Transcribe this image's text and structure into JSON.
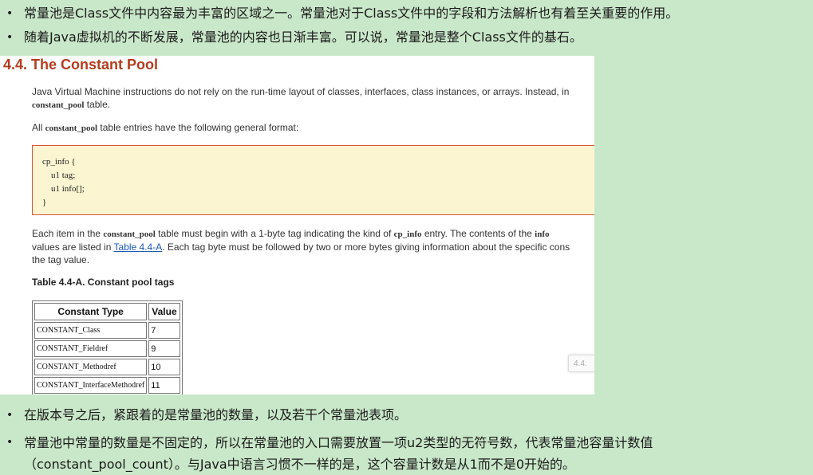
{
  "bullets": [
    {
      "symbol": "•",
      "text": "常量池是Class文件中内容最为丰富的区域之一。常量池对于Class文件中的字段和方法解析也有着至关重要的作用。"
    },
    {
      "symbol": "•",
      "text": "随着Java虚拟机的不断发展，常量池的内容也日渐丰富。可以说，常量池是整个Class文件的基石。"
    },
    {
      "symbol": "•",
      "text": "在版本号之后，紧跟着的是常量池的数量，以及若干个常量池表项。"
    },
    {
      "symbol": "•",
      "text": "常量池中常量的数量是不固定的，所以在常量池的入口需要放置一项u2类型的无符号数，代表常量池容量计数值（constant_pool_count）。与Java中语言习惯不一样的是，这个容量计数是从1而不是0开始的。"
    }
  ],
  "spec": {
    "heading": "4.4. The Constant Pool",
    "para1_a": "Java Virtual Machine instructions do not rely on the run-time layout of classes, interfaces, class instances, or arrays. Instead, in",
    "para1_code": "constant_pool",
    "para1_b": " table.",
    "para2_a": "All ",
    "para2_code": "constant_pool",
    "para2_b": " table entries have the following general format:",
    "code": "cp_info {\n    u1 tag;\n    u1 info[];\n}",
    "para3_a": "Each item in the ",
    "para3_code1": "constant_pool",
    "para3_b": " table must begin with a 1-byte tag indicating the kind of ",
    "para3_code2": "cp_info",
    "para3_c": " entry. The contents of the ",
    "para3_code3": "info",
    "para3_d": "values are listed in ",
    "para3_link": "Table 4.4-A",
    "para3_e": ". Each tag byte must be followed by two or more bytes giving information about the specific cons",
    "para3_f": "the tag value.",
    "table_caption": "Table 4.4-A. Constant pool tags",
    "table_headers": [
      "Constant Type",
      "Value"
    ],
    "table_rows": [
      [
        "CONSTANT_Class",
        "7"
      ],
      [
        "CONSTANT_Fieldref",
        "9"
      ],
      [
        "CONSTANT_Methodref",
        "10"
      ],
      [
        "CONSTANT_InterfaceMethodref",
        "11"
      ]
    ],
    "tooltip": "4.4."
  }
}
